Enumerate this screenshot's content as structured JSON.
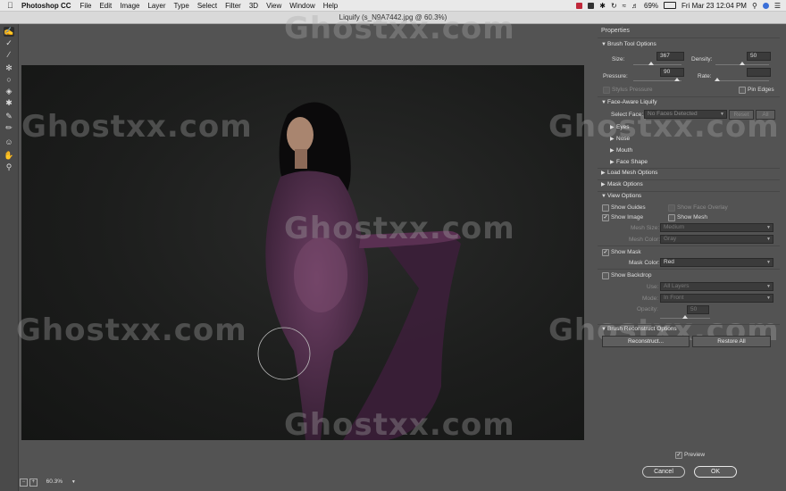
{
  "menubar": {
    "app": "Photoshop CC",
    "items": [
      "File",
      "Edit",
      "Image",
      "Layer",
      "Type",
      "Select",
      "Filter",
      "3D",
      "View",
      "Window",
      "Help"
    ],
    "battery": "69%",
    "clock": "Fri Mar 23  12:04 PM"
  },
  "window": {
    "title": "Liquify (s_N9A7442.jpg @ 60.3%)"
  },
  "watermark": "Ghostxx.com",
  "panel": {
    "title": "Properties",
    "brush": {
      "header": "Brush Tool Options",
      "size_label": "Size:",
      "size_value": "367",
      "size_fraction": 0.37,
      "density_label": "Density:",
      "density_value": "50",
      "density_fraction": 0.5,
      "pressure_label": "Pressure:",
      "pressure_value": "90",
      "pressure_fraction": 0.9,
      "rate_label": "Rate:",
      "rate_value": "",
      "rate_fraction": 0.0,
      "stylus": "Stylus Pressure",
      "pin_edges": "Pin Edges"
    },
    "face": {
      "header": "Face-Aware Liquify",
      "select_label": "Select Face:",
      "select_value": "No Faces Detected",
      "reset": "Reset",
      "all": "All",
      "sub": [
        "Eyes",
        "Nose",
        "Mouth",
        "Face Shape"
      ]
    },
    "load_mesh": "Load Mesh Options",
    "mask_opts": "Mask Options",
    "view": {
      "header": "View Options",
      "show_guides": "Show Guides",
      "show_face_overlay": "Show Face Overlay",
      "show_image": "Show Image",
      "show_mesh": "Show Mesh",
      "mesh_size_label": "Mesh Size:",
      "mesh_size": "Medium",
      "mesh_color_label": "Mesh Color:",
      "mesh_color": "Gray",
      "show_mask": "Show Mask",
      "mask_color_label": "Mask Color:",
      "mask_color": "Red",
      "show_backdrop": "Show Backdrop",
      "use_label": "Use:",
      "use": "All Layers",
      "mode_label": "Mode:",
      "mode": "In Front",
      "opacity_label": "Opacity:",
      "opacity": "50"
    },
    "reconstruct": {
      "header": "Brush Reconstruct Options",
      "reconstruct": "Reconstruct...",
      "restore": "Restore All"
    },
    "preview": "Preview",
    "cancel": "Cancel",
    "ok": "OK"
  },
  "zoom": "60.3%"
}
